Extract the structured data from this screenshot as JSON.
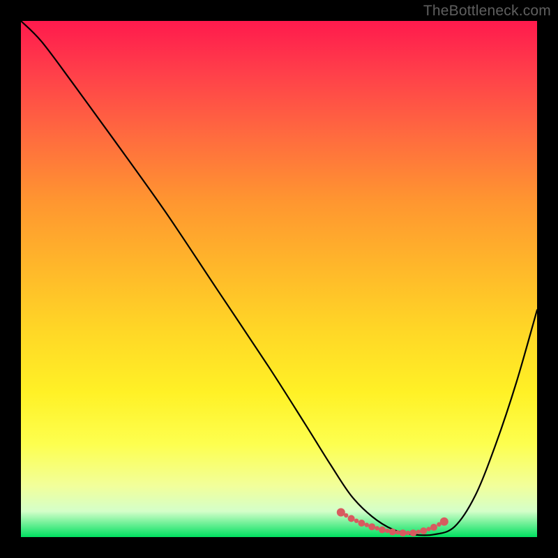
{
  "watermark": "TheBottleneck.com",
  "colors": {
    "curve": "#000000",
    "marker": "#d85a5f",
    "bg_top": "#ff1a4d",
    "bg_bottom": "#00e060",
    "frame": "#000000"
  },
  "chart_data": {
    "type": "line",
    "title": "",
    "xlabel": "",
    "ylabel": "",
    "xlim": [
      0,
      100
    ],
    "ylim": [
      0,
      100
    ],
    "series": [
      {
        "name": "bottleneck-curve",
        "x": [
          0,
          4,
          10,
          18,
          28,
          38,
          48,
          55,
          60,
          64,
          68,
          72,
          76,
          80,
          84,
          88,
          92,
          96,
          100
        ],
        "y": [
          100,
          96,
          88,
          77,
          63,
          48,
          33,
          22,
          14,
          8,
          4,
          1.5,
          0.5,
          0.5,
          2,
          8,
          18,
          30,
          44
        ]
      }
    ],
    "markers": {
      "name": "optimal-range",
      "x": [
        62,
        64,
        66,
        68,
        70,
        72,
        74,
        76,
        78,
        80,
        82
      ],
      "y": [
        4.8,
        3.6,
        2.7,
        2.0,
        1.4,
        1.0,
        0.8,
        0.8,
        1.2,
        1.9,
        3.0
      ]
    }
  }
}
